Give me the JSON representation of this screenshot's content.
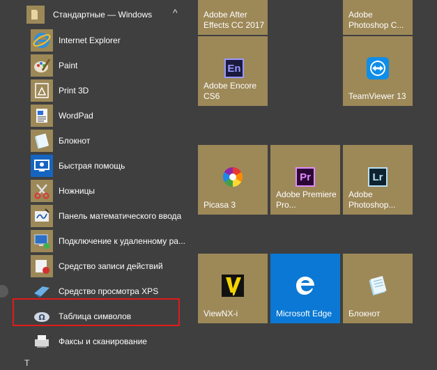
{
  "folder": {
    "label": "Стандартные — Windows",
    "chevron": "^",
    "icon": "folder-icon"
  },
  "apps": [
    {
      "label": "Internet Explorer",
      "icon": "ie-icon"
    },
    {
      "label": "Paint",
      "icon": "paint-icon"
    },
    {
      "label": "Print 3D",
      "icon": "print3d-icon"
    },
    {
      "label": "WordPad",
      "icon": "wordpad-icon"
    },
    {
      "label": "Блокнот",
      "icon": "notepad-icon"
    },
    {
      "label": "Быстрая помощь",
      "icon": "quick-assist-icon"
    },
    {
      "label": "Ножницы",
      "icon": "scissors-icon"
    },
    {
      "label": "Панель математического ввода",
      "icon": "math-input-icon"
    },
    {
      "label": "Подключение к удаленному ра...",
      "icon": "remote-desktop-icon"
    },
    {
      "label": "Средство записи действий",
      "icon": "steps-recorder-icon"
    },
    {
      "label": "Средство просмотра XPS",
      "icon": "xps-viewer-icon"
    },
    {
      "label": "Таблица символов",
      "icon": "charmap-icon"
    },
    {
      "label": "Факсы и сканирование",
      "icon": "fax-scan-icon"
    }
  ],
  "tiles": {
    "after_effects": "Adobe After Effects CC 2017",
    "photoshop_top": "Adobe Photoshop C...",
    "encore": "Adobe Encore CS6",
    "encore_glyph": "En",
    "teamviewer": "TeamViewer 13",
    "picasa": "Picasa 3",
    "premiere": "Adobe Premiere Pro...",
    "premiere_glyph": "Pr",
    "photoshop_lr": "Adobe Photoshop...",
    "lightroom_glyph": "Lr",
    "viewnx": "ViewNX-i",
    "edge": "Microsoft Edge",
    "notepad": "Блокнот"
  },
  "strip_letter": "T",
  "colors": {
    "background": "#3f3f3f",
    "tile": "#9d8858",
    "edge_tile": "#0a78d4",
    "highlight": "#e01b1b"
  }
}
